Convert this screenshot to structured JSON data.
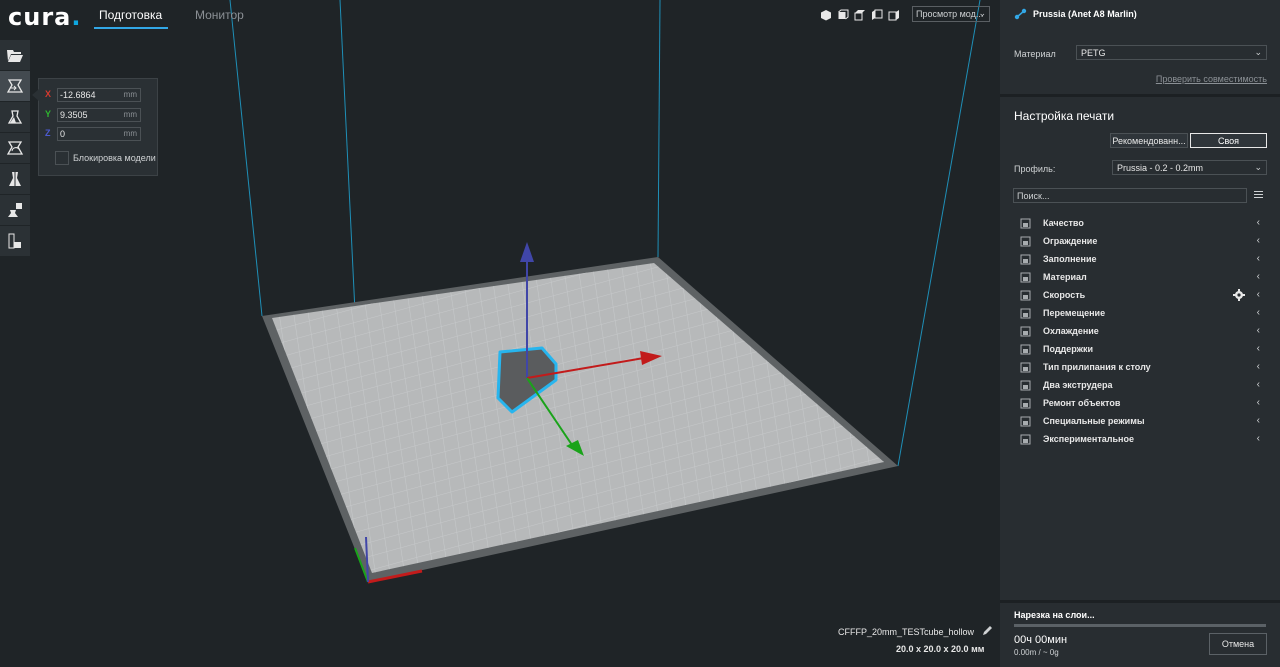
{
  "app": {
    "logo_text": "cura",
    "logo_dot": "."
  },
  "tabs": [
    {
      "label": "Подготовка",
      "active": true
    },
    {
      "label": "Монитор",
      "active": false
    }
  ],
  "view": {
    "select_label": "Просмотр мод...",
    "icons": [
      "3d-view-icon",
      "front-view-icon",
      "top-view-icon",
      "left-view-icon",
      "right-view-icon"
    ]
  },
  "toolbar": {
    "tools": [
      "open-file-icon",
      "move-tool-icon",
      "scale-tool-icon",
      "rotate-tool-icon",
      "mirror-tool-icon",
      "per-model-settings-icon",
      "support-blocker-icon"
    ],
    "selected_index": 1
  },
  "move_panel": {
    "x": {
      "label": "X",
      "value": "-12.6864",
      "unit": "mm"
    },
    "y": {
      "label": "Y",
      "value": "9.3505",
      "unit": "mm"
    },
    "z": {
      "label": "Z",
      "value": "0",
      "unit": "mm"
    },
    "lock_label": "Блокировка модели"
  },
  "scene": {
    "file_name": "CFFFP_20mm_TESTcube_hollow",
    "dimensions": "20.0 x 20.0 x 20.0 мм"
  },
  "right_panel": {
    "printer_name": "Prussia (Anet A8 Marlin)",
    "material_label": "Материал",
    "material_value": "PETG",
    "compat_link": "Проверить совместимость",
    "settings_title": "Настройка печати",
    "mode_recommended": "Рекомендованн...",
    "mode_custom": "Своя",
    "profile_label": "Профиль:",
    "profile_value": "Prussia - 0.2 - 0.2mm",
    "search_placeholder": "Поиск...",
    "categories": [
      {
        "label": "Качество",
        "icon": "quality-icon"
      },
      {
        "label": "Ограждение",
        "icon": "shell-icon"
      },
      {
        "label": "Заполнение",
        "icon": "infill-icon"
      },
      {
        "label": "Материал",
        "icon": "material-icon"
      },
      {
        "label": "Скорость",
        "icon": "speed-icon"
      },
      {
        "label": "Перемещение",
        "icon": "travel-icon"
      },
      {
        "label": "Охлаждение",
        "icon": "cooling-icon"
      },
      {
        "label": "Поддержки",
        "icon": "support-icon"
      },
      {
        "label": "Тип прилипания к столу",
        "icon": "adhesion-icon"
      },
      {
        "label": "Два экструдера",
        "icon": "dual-extrusion-icon"
      },
      {
        "label": "Ремонт объектов",
        "icon": "mesh-fixes-icon"
      },
      {
        "label": "Специальные режимы",
        "icon": "special-modes-icon"
      },
      {
        "label": "Экспериментальное",
        "icon": "experimental-icon"
      }
    ],
    "slice_label": "Нарезка на слои...",
    "time": "00ч 00мин",
    "usage": "0.00m / ~ 0g",
    "cancel_label": "Отмена"
  },
  "colors": {
    "accent": "#32a7e6",
    "axis_x": "#c21b1b",
    "axis_y": "#1aa31a",
    "axis_z": "#4046a8"
  }
}
